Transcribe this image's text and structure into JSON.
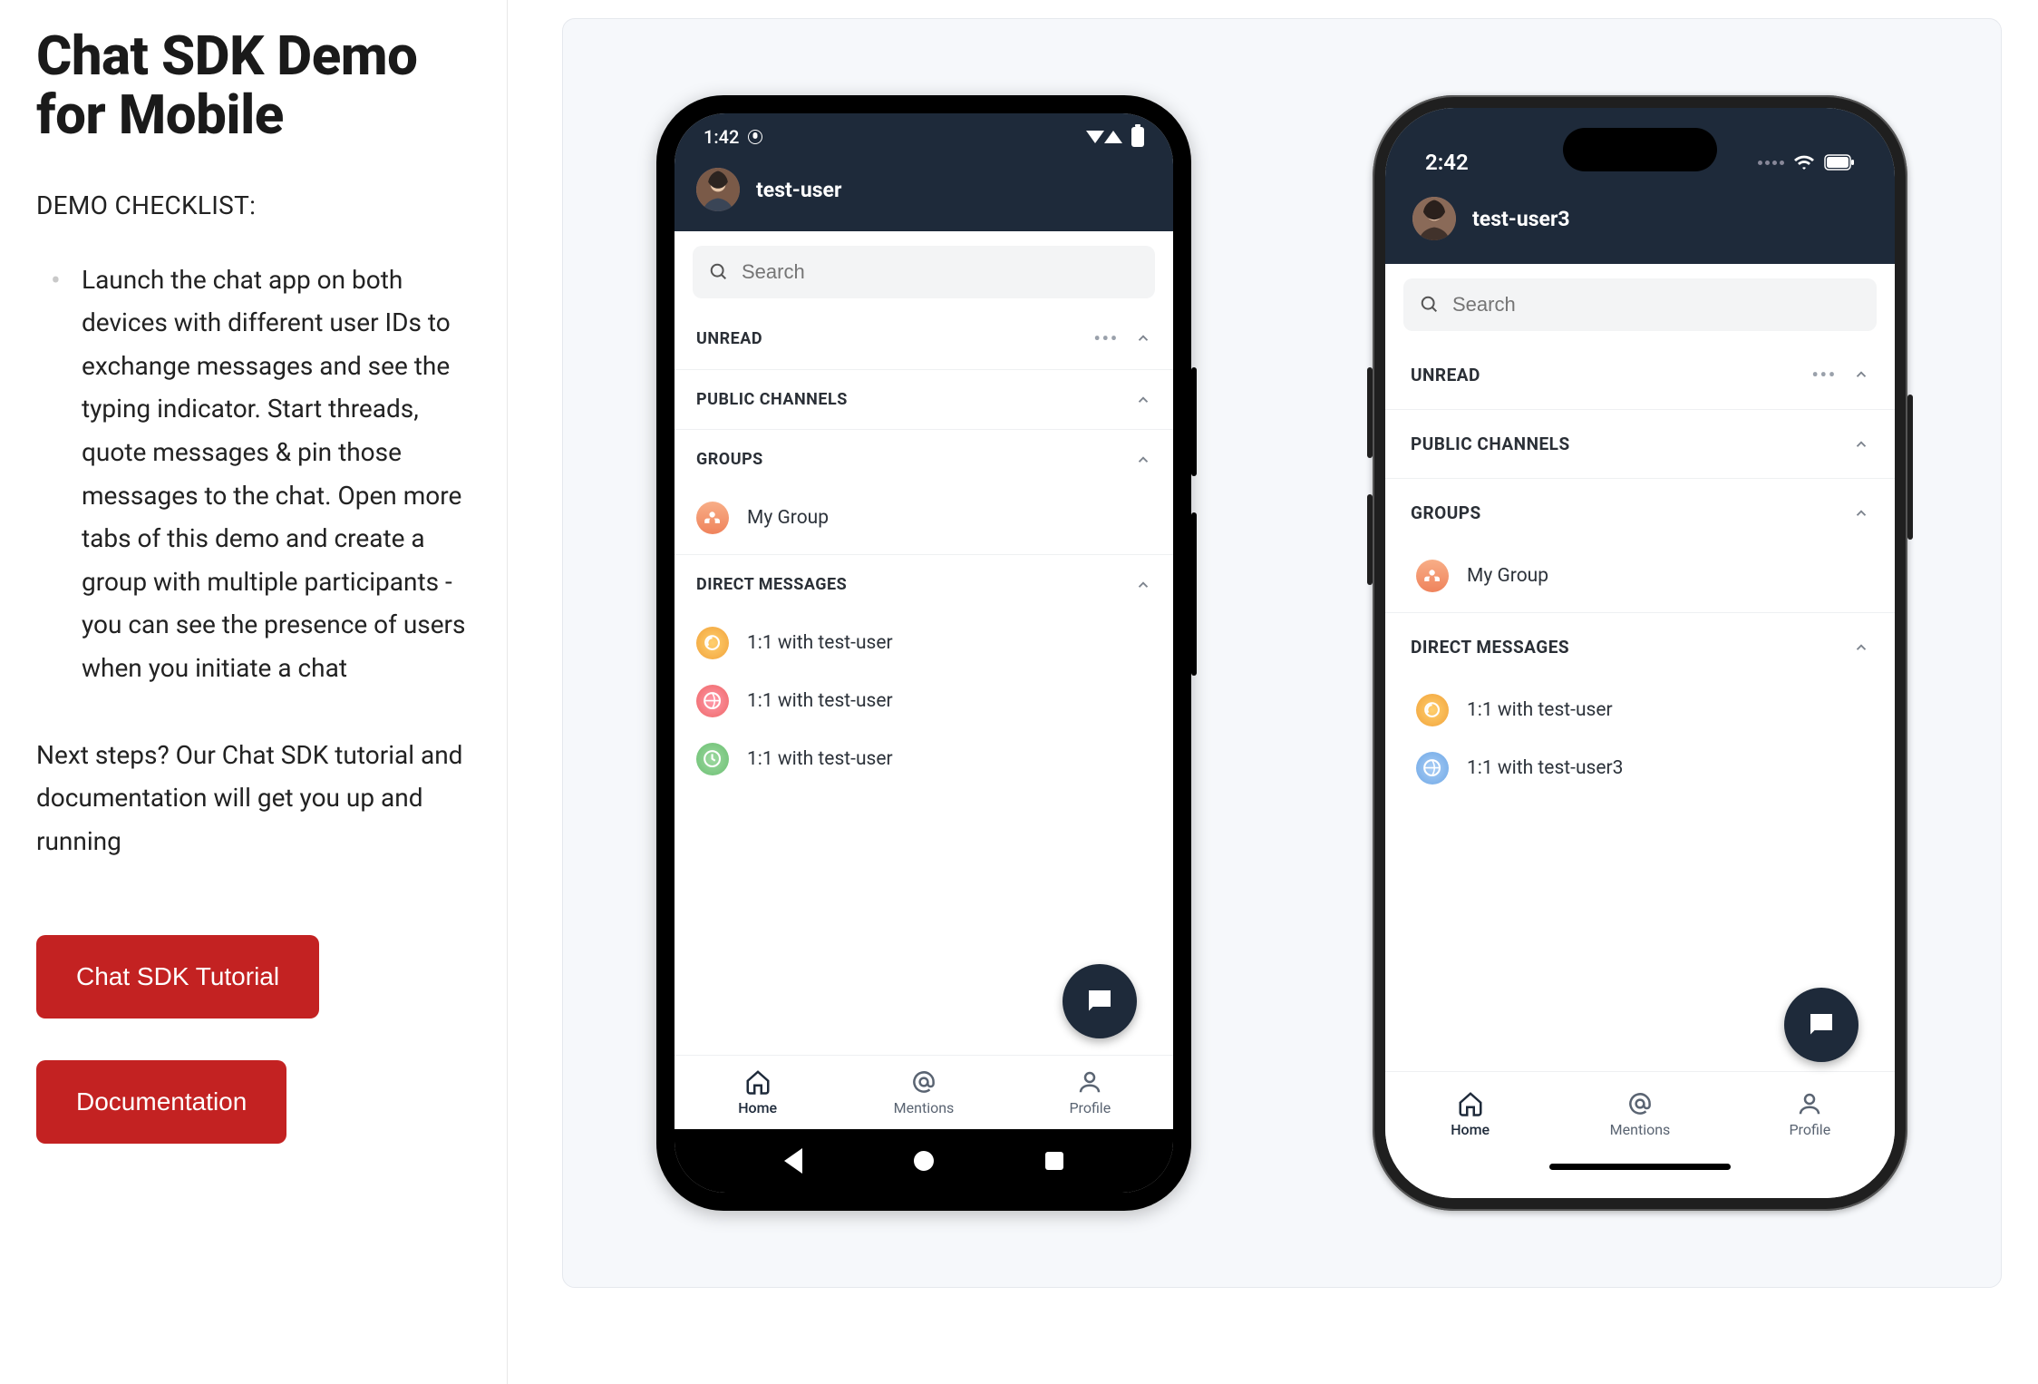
{
  "leftPanel": {
    "title": "Chat SDK Demo for Mobile",
    "checklistHeading": "DEMO CHECKLIST:",
    "checklistItem": "Launch the chat app on both devices with different user IDs to exchange messages and see the typing indicator. Start threads, quote messages & pin those messages to the chat. Open more tabs of this demo and create a group with multiple participants - you can see the presence of users when you initiate a chat",
    "nextSteps": "Next steps? Our Chat SDK tutorial and documentation will get you up and running",
    "tutorialButton": "Chat SDK Tutorial",
    "docsButton": "Documentation"
  },
  "android": {
    "status": {
      "time": "1:42"
    },
    "header": {
      "username": "test-user"
    },
    "search": {
      "placeholder": "Search"
    },
    "sections": {
      "unread": "UNREAD",
      "public": "PUBLIC CHANNELS",
      "groups": "GROUPS",
      "dm": "DIRECT MESSAGES"
    },
    "group": {
      "name": "My Group"
    },
    "dms": {
      "0": "1:1 with test-user",
      "1": "1:1 with test-user",
      "2": "1:1 with test-user"
    },
    "tabs": {
      "home": "Home",
      "mentions": "Mentions",
      "profile": "Profile"
    }
  },
  "ios": {
    "status": {
      "time": "2:42"
    },
    "header": {
      "username": "test-user3"
    },
    "search": {
      "placeholder": "Search"
    },
    "sections": {
      "unread": "UNREAD",
      "public": "PUBLIC CHANNELS",
      "groups": "GROUPS",
      "dm": "DIRECT MESSAGES"
    },
    "group": {
      "name": "My Group"
    },
    "dms": {
      "0": "1:1 with test-user",
      "1": "1:1 with test-user3"
    },
    "tabs": {
      "home": "Home",
      "mentions": "Mentions",
      "profile": "Profile"
    }
  }
}
